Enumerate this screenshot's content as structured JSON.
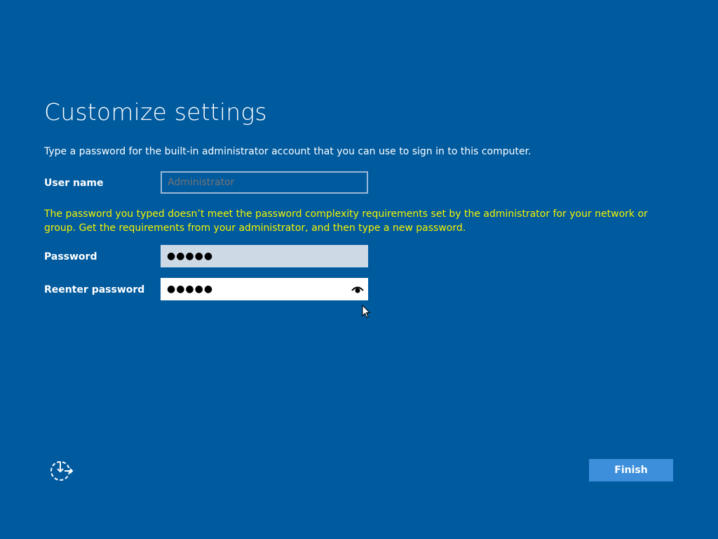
{
  "header": {
    "title": "Customize settings"
  },
  "main": {
    "instruction": "Type a password for the built-in administrator account that you can use to sign in to this computer.",
    "username": {
      "label": "User name",
      "placeholder": "Administrator",
      "value": ""
    },
    "error_message": "The password you typed doesn’t meet the password complexity requirements set by the administrator for your network or group. Get the requirements from your administrator, and then type a new password.",
    "password": {
      "label": "Password",
      "masked_value": "●●●●●"
    },
    "reenter_password": {
      "label": "Reenter password",
      "masked_value": "●●●●●",
      "reveal_icon": "eye-icon"
    }
  },
  "footer": {
    "ease_of_access_icon": "ease-of-access-icon",
    "finish_label": "Finish"
  },
  "colors": {
    "background": "#005a9e",
    "error_text": "#f4f400",
    "finish_button": "#3d8fdb",
    "password_field_bg": "#cdd9e5"
  }
}
